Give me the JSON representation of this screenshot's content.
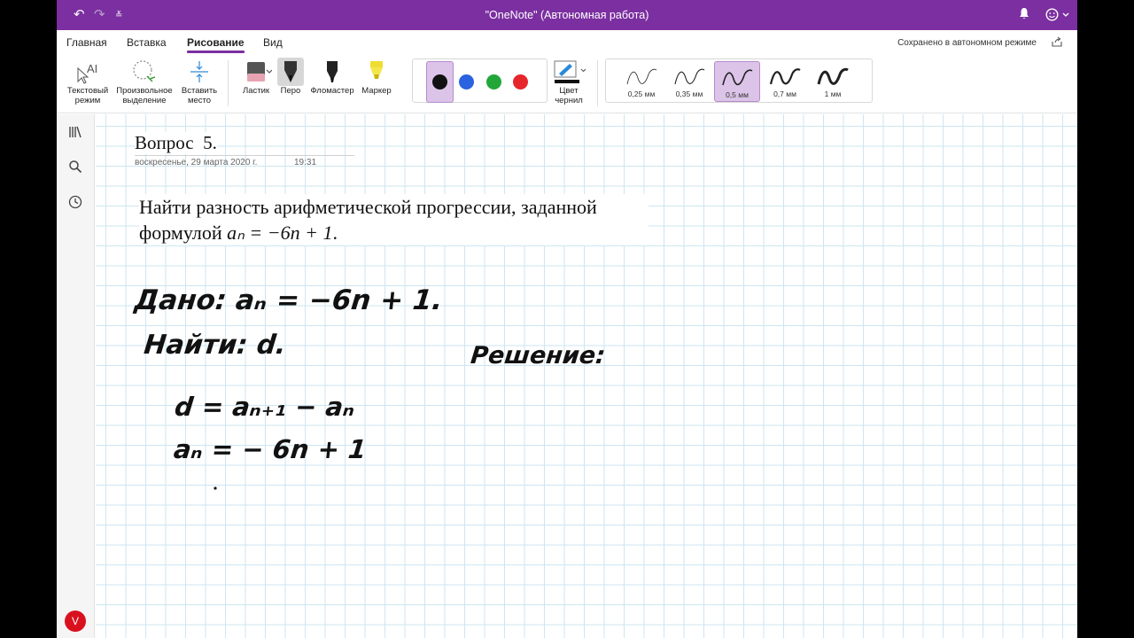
{
  "window": {
    "title": "\"OneNote\" (Автономная работа)"
  },
  "ribbon": {
    "tabs": [
      "Главная",
      "Вставка",
      "Рисование",
      "Вид"
    ],
    "active_tab": "Рисование",
    "saved_status": "Сохранено в автономном режиме"
  },
  "toolbar": {
    "text_mode": "Текстовый режим",
    "lasso_select": "Произвольное выделение",
    "insert_space": "Вставить место",
    "eraser": "Ластик",
    "pen": "Перо",
    "felt_tip": "Фломастер",
    "highlighter": "Маркер",
    "ink_color": "Цвет чернил",
    "colors": [
      "#111111",
      "#2a62e0",
      "#22a63a",
      "#e5262b"
    ],
    "selected_color": "#111111",
    "thicknesses": [
      "0,25 мм",
      "0,35 мм",
      "0,5 мм",
      "0,7 мм",
      "1 мм"
    ],
    "selected_thickness": "0,5 мм"
  },
  "page": {
    "title": "Вопрос  5.",
    "date": "воскресенье, 29 марта 2020 г.",
    "time": "19:31",
    "problem_line1": "Найти разность арифметической прогрессии, заданной",
    "problem_line2_prefix": "формулой",
    "problem_formula": "aₙ = −6n + 1",
    "problem_line2_suffix": ".",
    "handwriting": {
      "given": "Дано: aₙ = −6n + 1.",
      "find": "Найти: d.",
      "solution": "Решение:",
      "step1": "d = aₙ₊₁ − aₙ",
      "step2": "aₙ = − 6n + 1"
    }
  },
  "user": {
    "initial": "V"
  },
  "ui_colors": {
    "accent": "#7b2fa0",
    "grid": "#cde6f2"
  }
}
